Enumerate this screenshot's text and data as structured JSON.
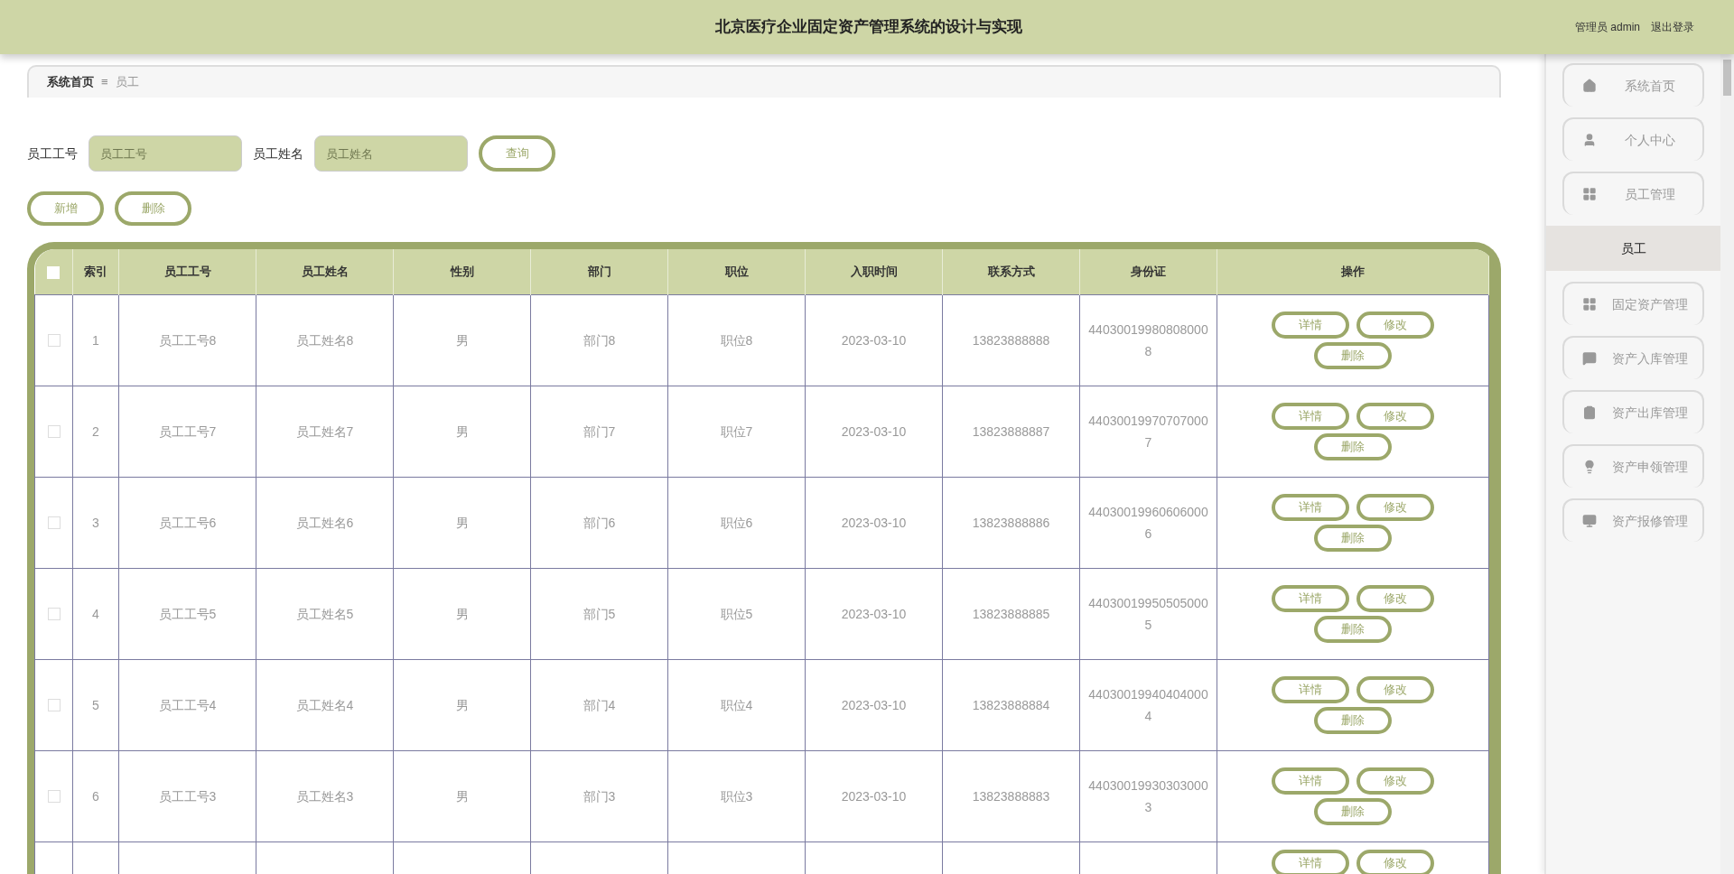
{
  "header": {
    "title": "北京医疗企业固定资产管理系统的设计与实现",
    "user": "管理员 admin",
    "logout": "退出登录"
  },
  "breadcrumb": {
    "items": [
      "系统首页",
      "员工"
    ],
    "separator": "≡"
  },
  "search": {
    "fields": [
      {
        "label": "员工工号",
        "placeholder": "员工工号"
      },
      {
        "label": "员工姓名",
        "placeholder": "员工姓名"
      }
    ],
    "button": "查询"
  },
  "actions": [
    "新增",
    "删除"
  ],
  "table": {
    "header_checked": false,
    "columns": [
      "索引",
      "员工工号",
      "员工姓名",
      "性别",
      "部门",
      "职位",
      "入职时间",
      "联系方式",
      "身份证",
      "操作"
    ],
    "rows": [
      {
        "checked": false,
        "cells": [
          "1",
          "员工工号8",
          "员工姓名8",
          "男",
          "部门8",
          "职位8",
          "2023-03-10",
          "13823888888",
          "440300199808080008"
        ],
        "actions": [
          "详情",
          "修改",
          "删除"
        ]
      },
      {
        "checked": false,
        "cells": [
          "2",
          "员工工号7",
          "员工姓名7",
          "男",
          "部门7",
          "职位7",
          "2023-03-10",
          "13823888887",
          "440300199707070007"
        ],
        "actions": [
          "详情",
          "修改",
          "删除"
        ]
      },
      {
        "checked": false,
        "cells": [
          "3",
          "员工工号6",
          "员工姓名6",
          "男",
          "部门6",
          "职位6",
          "2023-03-10",
          "13823888886",
          "440300199606060006"
        ],
        "actions": [
          "详情",
          "修改",
          "删除"
        ]
      },
      {
        "checked": false,
        "cells": [
          "4",
          "员工工号5",
          "员工姓名5",
          "男",
          "部门5",
          "职位5",
          "2023-03-10",
          "13823888885",
          "440300199505050005"
        ],
        "actions": [
          "详情",
          "修改",
          "删除"
        ]
      },
      {
        "checked": false,
        "cells": [
          "5",
          "员工工号4",
          "员工姓名4",
          "男",
          "部门4",
          "职位4",
          "2023-03-10",
          "13823888884",
          "440300199404040004"
        ],
        "actions": [
          "详情",
          "修改",
          "删除"
        ]
      },
      {
        "checked": false,
        "cells": [
          "6",
          "员工工号3",
          "员工姓名3",
          "男",
          "部门3",
          "职位3",
          "2023-03-10",
          "13823888883",
          "440300199303030003"
        ],
        "actions": [
          "详情",
          "修改",
          "删除"
        ]
      },
      {
        "cells": [],
        "actions": [
          "详情",
          "修改"
        ]
      }
    ]
  },
  "sidebar": {
    "items": [
      {
        "label": "系统首页",
        "selected": false
      },
      {
        "label": "个人中心",
        "selected": false
      },
      {
        "label": "员工管理",
        "selected": false,
        "children": [
          {
            "label": "员工",
            "selected": true
          }
        ]
      },
      {
        "label": "固定资产管理",
        "selected": false
      },
      {
        "label": "资产入库管理",
        "selected": false
      },
      {
        "label": "资产出库管理",
        "selected": false
      },
      {
        "label": "资产申领管理",
        "selected": false
      },
      {
        "label": "资产报修管理",
        "selected": false
      }
    ]
  }
}
